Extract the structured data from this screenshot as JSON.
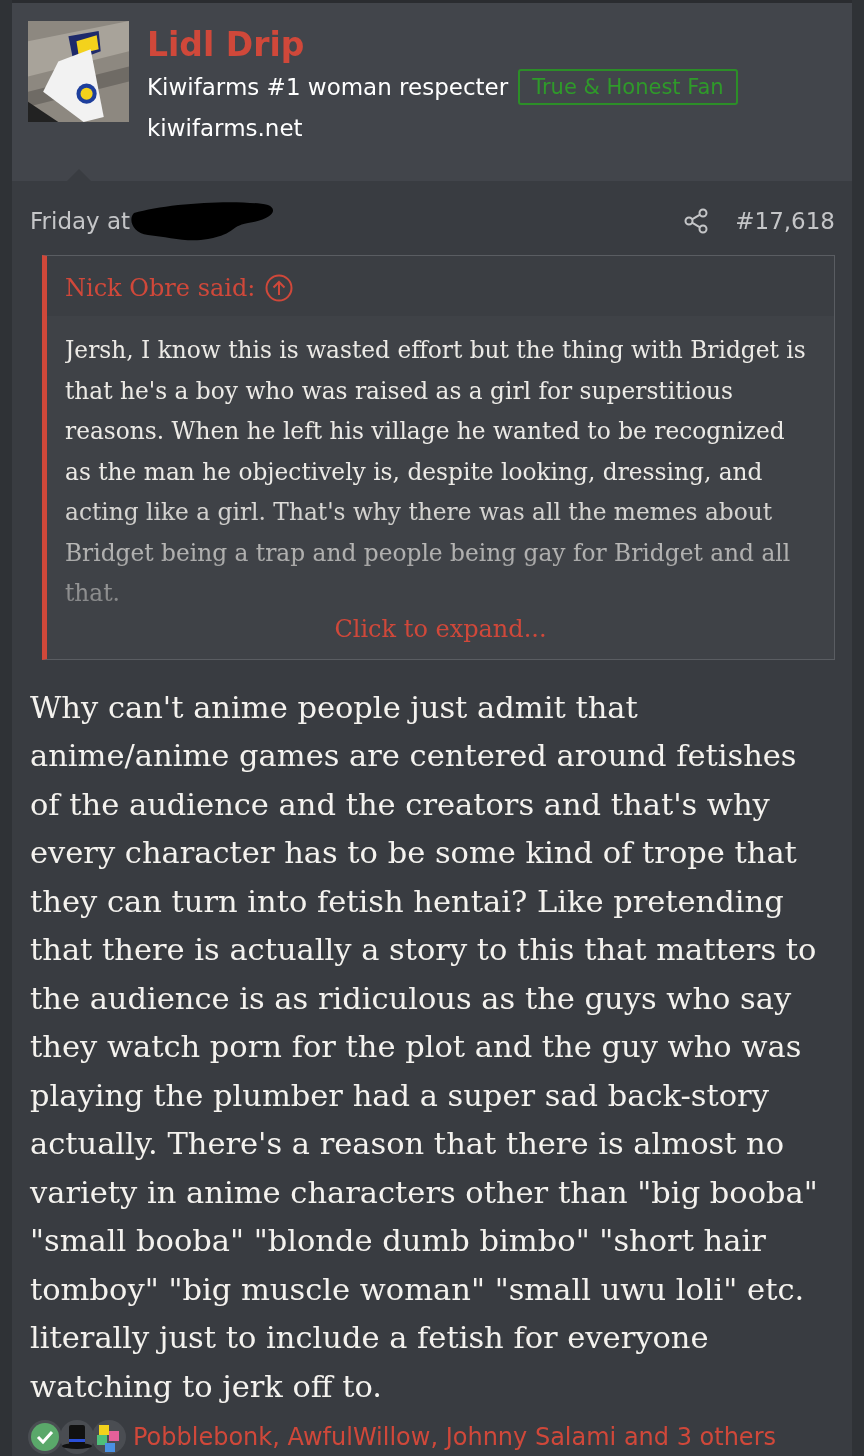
{
  "post": {
    "author": {
      "name": "Lidl Drip",
      "user_title": "Kiwifarms #1 woman respecter",
      "banner": "True & Honest Fan",
      "site": "kiwifarms.net"
    },
    "date": "Friday at",
    "number": "#17,618",
    "quote": {
      "attribution": "Nick Obre said:",
      "text": "Jersh, I know this is wasted effort but the thing with Bridget is that he's a boy who was raised as a girl for superstitious reasons. When he left his village he wanted to be recognized as the man he objectively is, despite looking, dressing, and acting like a girl. That's why there was all the memes about Bridget being a trap and people being gay for Bridget and all that.",
      "expand": "Click to expand..."
    },
    "body": "Why can't anime people just admit that anime/anime games are centered around fetishes of the audience and the creators and that's why every character has to be some kind of trope that they can turn into fetish hentai? Like pretending that there is actually a story to this that matters to the audience is as ridiculous as the guys who say they watch porn for the plot and the guy who was playing the plumber had a super sad back-story actually. There's a reason that there is almost no variety in anime characters other than \"big booba\" \"small booba\" \"blonde dumb bimbo\" \"short hair tomboy\" \"big muscle woman\" \"small uwu loli\" etc. literally just to include a fetish for everyone watching to jerk off to.",
    "reactions": {
      "text": "Pobblebonk, AwfulWillow, Johnny Salami and 3 others"
    }
  }
}
